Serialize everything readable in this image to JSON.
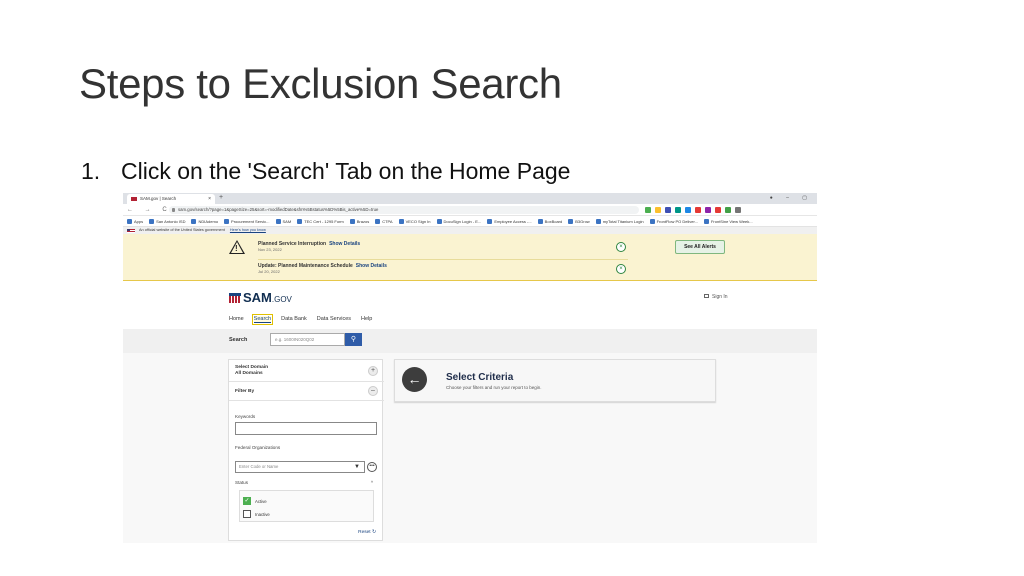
{
  "slide": {
    "title": "Steps to Exclusion Search",
    "step_number": "1.",
    "step_text": "Click on the 'Search' Tab on the Home Page"
  },
  "browser": {
    "tab_title": "SAM.gov | Search",
    "tab_close": "×",
    "new_tab": "+",
    "window_controls": "● – ▢",
    "nav_buttons": "← → C ⌂",
    "url": "sam.gov/search/?page=1&pageSize=25&sort=-modifiedDate&sfm%5Bstatus%5D%5Bis_active%5D=true",
    "extension_colors": [
      "#4caf50",
      "#fbc02d",
      "#3f51b5",
      "#009688",
      "#1e88e5",
      "#e53935",
      "#8e24aa",
      "#e53935",
      "#43a047",
      "#757575"
    ],
    "bookmarks": [
      "Apps",
      "San Antonio ISD",
      "NDIAdemo",
      "Procurement Servic...",
      "SAM",
      "TEC Cert - 1295 Form",
      "Brazos",
      "CTPA",
      "VECO Sign In",
      "DocuSign Login - E...",
      "Employee Access -...",
      "BoxBoard",
      "B3Grow",
      "myTotal Titanium Login",
      "FrontFlow PO Deliver...",
      "FrontSine View Week..."
    ]
  },
  "gov_banner": {
    "text": "An official website of the United States government",
    "link": "Here's how you know"
  },
  "alerts": [
    {
      "title": "Planned Service Interruption",
      "link": "Show Details",
      "date": "Nov 23, 2022"
    },
    {
      "title": "Update: Planned Maintenance Schedule",
      "link": "Show Details",
      "date": "Jul 20, 2022"
    }
  ],
  "alert_close": "×",
  "warning_mark": "!",
  "see_all_alerts": "See All Alerts",
  "header": {
    "logo_main": "SAM",
    "logo_suffix": ".GOV",
    "sign_in": "Sign In"
  },
  "nav": [
    "Home",
    "Search",
    "Data Bank",
    "Data Services",
    "Help"
  ],
  "search": {
    "label": "Search",
    "placeholder": "e.g. 1600IN020Q02",
    "button_icon": "search-icon",
    "button_glyph": "⚲"
  },
  "filter": {
    "select_domain_label": "Select Domain",
    "select_domain_value": "All Domains",
    "plus": "+",
    "filter_by": "Filter By",
    "minus": "–",
    "keywords_label": "Keywords",
    "federal_org_label": "Federal Organizations",
    "federal_org_placeholder": "Enter Code or Name",
    "caret": "▼",
    "more": "•••",
    "status_label": "Status",
    "status_chevron": "^",
    "status_options": [
      {
        "label": "Active",
        "checked": true
      },
      {
        "label": "Inactive",
        "checked": false
      }
    ],
    "checkmark": "✓",
    "reset": "Reset ↻"
  },
  "criteria": {
    "arrow": "←",
    "title": "Select Criteria",
    "subtitle": "Choose your filters and run your report to begin."
  },
  "colors": {
    "accent": "#1a4480",
    "alert_bg": "#faf3d1",
    "success": "#2e8540",
    "search_button": "#2f5ca8"
  }
}
